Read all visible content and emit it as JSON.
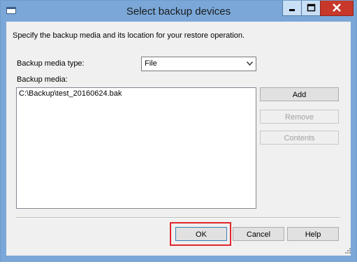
{
  "window": {
    "title": "Select backup devices"
  },
  "dialog": {
    "instruction": "Specify the backup media and its location for your restore operation.",
    "media_type_label": "Backup media type:",
    "media_type_value": "File",
    "media_label": "Backup media:",
    "media_items": [
      "C:\\Backup\\test_20160624.bak"
    ]
  },
  "buttons": {
    "add": "Add",
    "remove": "Remove",
    "contents": "Contents",
    "ok": "OK",
    "cancel": "Cancel",
    "help": "Help"
  },
  "icons": {
    "system_menu": "system-menu-icon",
    "minimize": "minimize-icon",
    "maximize": "maximize-icon",
    "close": "close-icon",
    "dropdown": "chevron-down-icon",
    "size_grip": "size-grip-icon"
  },
  "colors": {
    "titlebar": "#7aa7d8",
    "close_button": "#c7382b",
    "highlight_box": "#e0262b"
  }
}
